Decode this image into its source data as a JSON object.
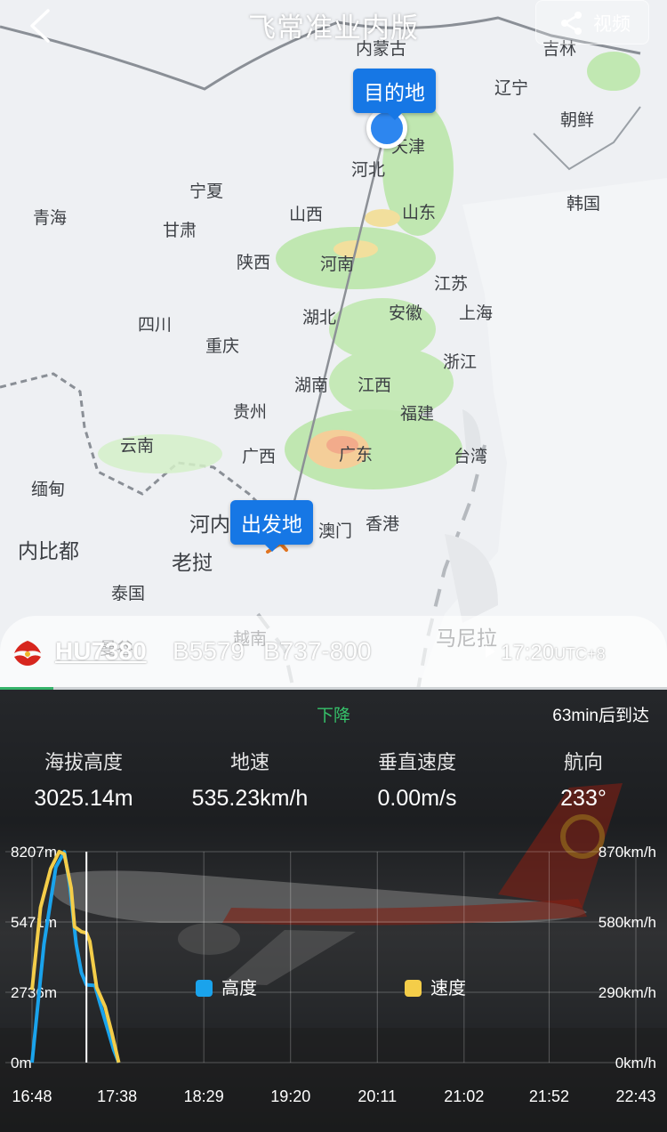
{
  "header": {
    "title": "飞常准业内版",
    "share_label": "视频"
  },
  "map": {
    "places": [
      {
        "name": "内蒙古",
        "big": false
      },
      {
        "name": "吉林",
        "big": false
      },
      {
        "name": "辽宁",
        "big": false
      },
      {
        "name": "朝鲜",
        "big": false
      },
      {
        "name": "天津",
        "big": false
      },
      {
        "name": "河北",
        "big": false
      },
      {
        "name": "宁夏",
        "big": false
      },
      {
        "name": "青海",
        "big": false
      },
      {
        "name": "甘肃",
        "big": false
      },
      {
        "name": "山西",
        "big": false
      },
      {
        "name": "山东",
        "big": false
      },
      {
        "name": "韩国",
        "big": false
      },
      {
        "name": "陕西",
        "big": false
      },
      {
        "name": "河南",
        "big": false
      },
      {
        "name": "江苏",
        "big": false
      },
      {
        "name": "四川",
        "big": false
      },
      {
        "name": "湖北",
        "big": false
      },
      {
        "name": "安徽",
        "big": false
      },
      {
        "name": "上海",
        "big": false
      },
      {
        "name": "重庆",
        "big": false
      },
      {
        "name": "浙江",
        "big": false
      },
      {
        "name": "湖南",
        "big": false
      },
      {
        "name": "江西",
        "big": false
      },
      {
        "name": "贵州",
        "big": false
      },
      {
        "name": "福建",
        "big": false
      },
      {
        "name": "云南",
        "big": false
      },
      {
        "name": "广西",
        "big": false
      },
      {
        "name": "广东",
        "big": false
      },
      {
        "name": "台湾",
        "big": false
      },
      {
        "name": "缅甸",
        "big": false
      },
      {
        "name": "河内",
        "big": true
      },
      {
        "name": "澳门",
        "big": false
      },
      {
        "name": "香港",
        "big": false
      },
      {
        "name": "内比都",
        "big": true
      },
      {
        "name": "老挝",
        "big": true
      },
      {
        "name": "泰国",
        "big": false
      },
      {
        "name": "越南",
        "big": false
      },
      {
        "name": "马尼拉",
        "big": true
      },
      {
        "name": "曼谷",
        "big": false
      }
    ],
    "destination_label": "目的地",
    "origin_label": "出发地"
  },
  "flight": {
    "number": "HU7380",
    "registration": "B5579",
    "aircraft": "B737-800",
    "playback_time": "17:20",
    "timezone": "UTC+8",
    "progress": 0.08
  },
  "panel": {
    "phase": "下降",
    "eta": "63min后到达",
    "stats": [
      {
        "label": "海拔高度",
        "value": "3025.14m"
      },
      {
        "label": "地速",
        "value": "535.23km/h"
      },
      {
        "label": "垂直速度",
        "value": "0.00m/s"
      },
      {
        "label": "航向",
        "value": "233°"
      }
    ]
  },
  "chart_data": {
    "type": "line",
    "x": [
      "16:48",
      "17:38",
      "18:29",
      "19:20",
      "20:11",
      "21:02",
      "21:52",
      "22:43"
    ],
    "y_left_ticks": [
      "8207m",
      "5471m",
      "2736m",
      "0m"
    ],
    "y_right_ticks": [
      "870km/h",
      "580km/h",
      "290km/h",
      "0km/h"
    ],
    "y_left_range": [
      0,
      8207
    ],
    "y_right_range": [
      0,
      870
    ],
    "cursor_time": "17:20",
    "legend_placement": "center",
    "series": [
      {
        "name": "高度",
        "color": "#1aa3ec",
        "axis": "left",
        "points": [
          [
            "16:48",
            0
          ],
          [
            "16:55",
            4600
          ],
          [
            "17:02",
            7600
          ],
          [
            "17:07",
            8200
          ],
          [
            "17:10",
            7000
          ],
          [
            "17:14",
            4600
          ],
          [
            "17:17",
            3500
          ],
          [
            "17:20",
            3025
          ],
          [
            "17:25",
            3000
          ],
          [
            "17:28",
            2300
          ],
          [
            "17:32",
            1400
          ],
          [
            "17:36",
            500
          ],
          [
            "17:39",
            0
          ]
        ]
      },
      {
        "name": "速度",
        "color": "#f4cd49",
        "axis": "right",
        "points": [
          [
            "16:48",
            300
          ],
          [
            "16:53",
            640
          ],
          [
            "16:59",
            800
          ],
          [
            "17:04",
            870
          ],
          [
            "17:07",
            860
          ],
          [
            "17:11",
            720
          ],
          [
            "17:13",
            560
          ],
          [
            "17:17",
            540
          ],
          [
            "17:20",
            535
          ],
          [
            "17:22",
            500
          ],
          [
            "17:26",
            310
          ],
          [
            "17:31",
            230
          ],
          [
            "17:35",
            120
          ],
          [
            "17:39",
            0
          ]
        ]
      }
    ]
  }
}
